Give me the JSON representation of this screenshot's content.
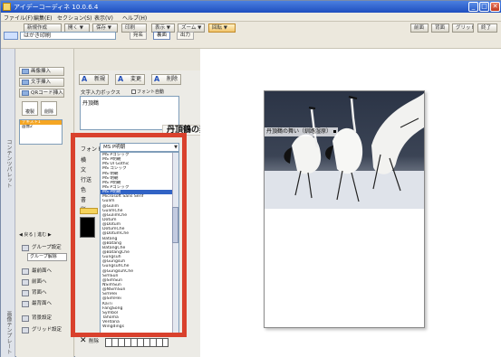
{
  "window": {
    "title": "アイデーコーディネ 10.0.6.4",
    "min_symbol": "_",
    "max_symbol": "□",
    "close_symbol": "✕"
  },
  "menu": [
    "ファイル(F)",
    "編集(E)",
    "セクション(S)",
    "表示(V)",
    "ヘルプ(H)"
  ],
  "toolbar": {
    "row1": [
      {
        "label": "新規作成",
        "style": "plain"
      },
      {
        "label": "開く ▼",
        "style": "plain"
      },
      {
        "label": "保存 ▼",
        "style": "plain"
      },
      {
        "label": "印刷",
        "style": "plain"
      },
      {
        "label": "表示 ▼",
        "style": "plain"
      },
      {
        "label": "ズーム ▼",
        "style": "plain"
      },
      {
        "label": "回転 ▼",
        "style": "orange"
      }
    ],
    "row1_right": [
      "前面",
      "背面",
      "グリッド",
      "終了"
    ],
    "document_name": "はがき印刷",
    "tabs": [
      "宛名",
      "裏面",
      "出力"
    ]
  },
  "sidebar_left": {
    "vertical_label_top": "コンテンツパレット",
    "vertical_label_bottom": "画像テンプレート"
  },
  "panel1": {
    "buttons": [
      "画像挿入",
      "文字挿入",
      "QRコード挿入"
    ],
    "square_buttons": [
      "複製",
      "削除"
    ],
    "layer_items": [
      "テキスト1",
      "画像2"
    ],
    "nav": "◀ 戻る | 進む ▶",
    "group_buttons": [
      "グループ設定",
      "最前面へ",
      "前面へ",
      "背面へ",
      "最背面へ"
    ],
    "group_sub": "グループ解除",
    "layout_buttons": [
      "背景設定",
      "グリッド設定"
    ]
  },
  "panel2": {
    "tool_buttons": [
      "新規",
      "変更",
      "削除"
    ],
    "textbox_label": "文字入力ボックス",
    "checkbox_label": "フォント自動",
    "textarea_value": "丹頂鶴",
    "big_text_chip": "丹頂鶴の舞い",
    "font_label": "フォント",
    "font_value": "MS P明朝",
    "prop_labels": [
      "横",
      "文",
      "行送",
      "色",
      "書",
      "影"
    ],
    "font_options": [
      "MS Pゴシック",
      "MS P明朝",
      "MS UI Gothic",
      "MS ゴシック",
      "MS 明朝",
      "MS 明朝",
      "MS P明朝",
      "MS Pゴシック",
      "MS P明朝",
      "Microsoft Sans Serif",
      "Gulim",
      "@Gulim",
      "GulimChe",
      "@GulimChe",
      "Dotum",
      "@Dotum",
      "DotumChe",
      "@DotumChe",
      "Batang",
      "@Batang",
      "BatangChe",
      "@BatangChe",
      "Gungsuh",
      "@Gungsuh",
      "GungsuhChe",
      "@GungsuhChe",
      "SimSun",
      "@SimSun",
      "NSimSun",
      "@NSimSun",
      "SimHei",
      "@SimHei",
      "KaiTi",
      "FangSong",
      "Symbol",
      "Tahoma",
      "Verdana",
      "Wingdings"
    ],
    "selected_font_index": 8,
    "delete_label": "削除",
    "accent_color": "#d9412d"
  },
  "canvas": {
    "text_marker": "丹頂鶴の舞い（釧路湿原）"
  }
}
